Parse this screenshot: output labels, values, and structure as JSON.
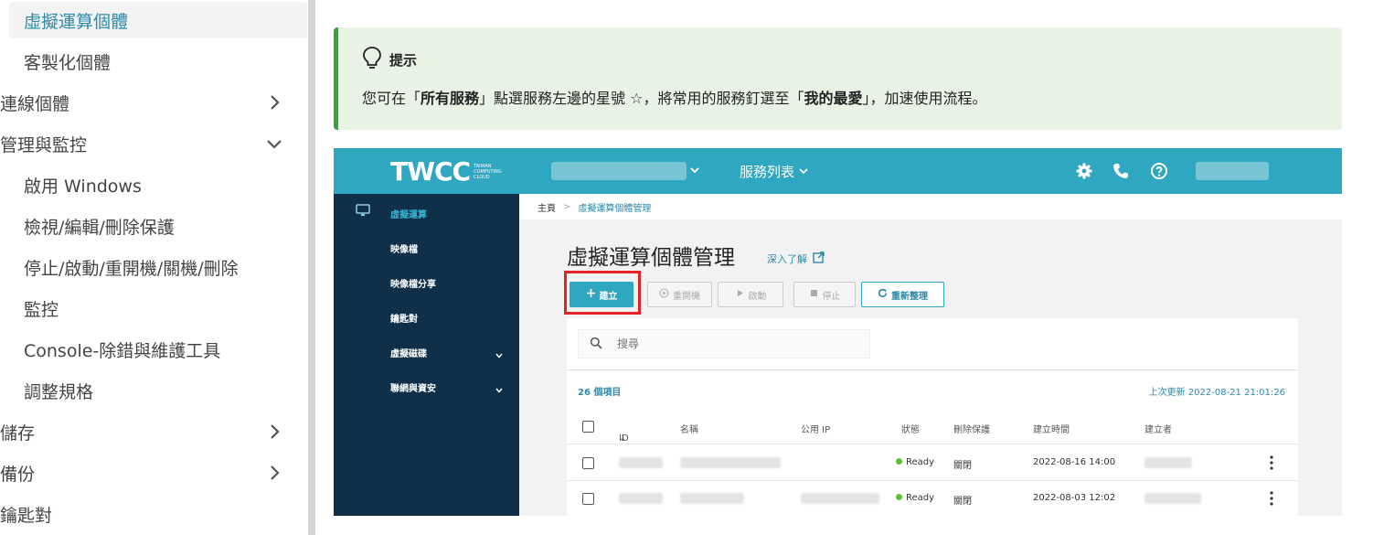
{
  "doc_nav": {
    "items": [
      {
        "label": "虛擬運算個體",
        "indent": true,
        "active": true
      },
      {
        "label": "客製化個體",
        "indent": true
      },
      {
        "label": "連線個體",
        "indent": false,
        "chevron": "chevron-right-icon"
      },
      {
        "label": "管理與監控",
        "indent": false,
        "chevron": "chevron-down-icon"
      },
      {
        "label": "啟用 Windows",
        "indent": true
      },
      {
        "label": "檢視/編輯/刪除保護",
        "indent": true
      },
      {
        "label": "停止/啟動/重開機/關機/刪除",
        "indent": true
      },
      {
        "label": "監控",
        "indent": true
      },
      {
        "label": "Console-除錯與維護工具",
        "indent": true
      },
      {
        "label": "調整規格",
        "indent": true
      },
      {
        "label": "儲存",
        "indent": false,
        "chevron": "chevron-right-icon"
      },
      {
        "label": "備份",
        "indent": false,
        "chevron": "chevron-right-icon"
      },
      {
        "label": "鑰匙對",
        "indent": false
      }
    ]
  },
  "tip": {
    "title": "提示",
    "body_prefix": "您可在「",
    "bold_1": "所有服務",
    "body_mid": "」點選服務左邊的星號 ☆，將常用的服務釘選至「",
    "bold_2": "我的最愛",
    "body_suffix": "」，加速使用流程。"
  },
  "portal": {
    "logo": {
      "word": "TWCC",
      "small": "TAIWAN COMPUTING CLOUD"
    },
    "services_menu": "服務列表",
    "sidebar": [
      {
        "label": "虛擬運算",
        "active": true
      },
      {
        "label": "映像檔"
      },
      {
        "label": "映像檔分享"
      },
      {
        "label": "鑰匙對"
      },
      {
        "label": "虛擬磁碟",
        "chevron": true
      },
      {
        "label": "聯網與資安",
        "chevron": true
      }
    ],
    "breadcrumb": {
      "home": "主頁",
      "sep": ">",
      "current": "虛擬運算個體管理"
    },
    "page_title": "虛擬運算個體管理",
    "learn_more": "深入了解",
    "buttons": {
      "create": "建立",
      "reboot": "重開機",
      "start": "啟動",
      "stop": "停止",
      "refresh": "重新整理"
    },
    "search_placeholder": "搜尋",
    "item_count": "26 個項目",
    "last_updated": "上次更新 2022-08-21 21:01:26",
    "columns": {
      "id": "ID",
      "name": "名稱",
      "public_ip": "公用 IP",
      "status": "狀態",
      "delete_protection": "刪除保護",
      "created_at": "建立時間",
      "creator": "建立者"
    },
    "rows": [
      {
        "status": "Ready",
        "delete_protection": "關閉",
        "created_at": "2022-08-16 14:00"
      },
      {
        "status": "Ready",
        "delete_protection": "關閉",
        "created_at": "2022-08-03 12:02"
      }
    ],
    "colors": {
      "topbar": "#30a7c0",
      "sidebar": "#10304a",
      "accent": "#2b8aaa",
      "highlight": "#e4222a",
      "ready": "#5cbf3b"
    }
  }
}
